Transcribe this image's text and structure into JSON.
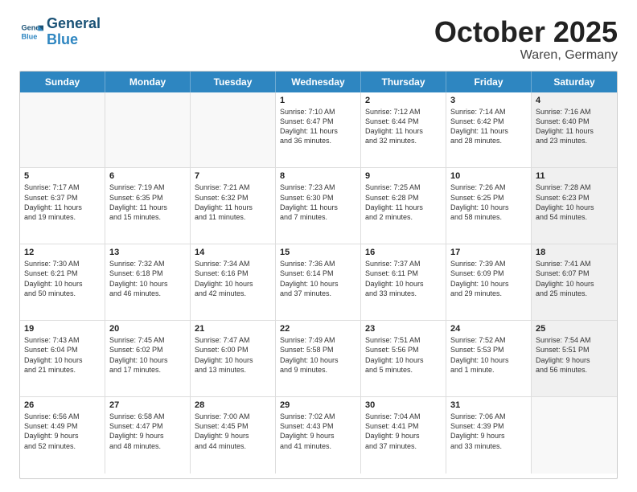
{
  "logo": {
    "line1": "General",
    "line2": "Blue"
  },
  "title": "October 2025",
  "location": "Waren, Germany",
  "header_days": [
    "Sunday",
    "Monday",
    "Tuesday",
    "Wednesday",
    "Thursday",
    "Friday",
    "Saturday"
  ],
  "weeks": [
    [
      {
        "day": "",
        "text": "",
        "empty": true
      },
      {
        "day": "",
        "text": "",
        "empty": true
      },
      {
        "day": "",
        "text": "",
        "empty": true
      },
      {
        "day": "1",
        "text": "Sunrise: 7:10 AM\nSunset: 6:47 PM\nDaylight: 11 hours\nand 36 minutes."
      },
      {
        "day": "2",
        "text": "Sunrise: 7:12 AM\nSunset: 6:44 PM\nDaylight: 11 hours\nand 32 minutes."
      },
      {
        "day": "3",
        "text": "Sunrise: 7:14 AM\nSunset: 6:42 PM\nDaylight: 11 hours\nand 28 minutes."
      },
      {
        "day": "4",
        "text": "Sunrise: 7:16 AM\nSunset: 6:40 PM\nDaylight: 11 hours\nand 23 minutes.",
        "shaded": true
      }
    ],
    [
      {
        "day": "5",
        "text": "Sunrise: 7:17 AM\nSunset: 6:37 PM\nDaylight: 11 hours\nand 19 minutes."
      },
      {
        "day": "6",
        "text": "Sunrise: 7:19 AM\nSunset: 6:35 PM\nDaylight: 11 hours\nand 15 minutes."
      },
      {
        "day": "7",
        "text": "Sunrise: 7:21 AM\nSunset: 6:32 PM\nDaylight: 11 hours\nand 11 minutes."
      },
      {
        "day": "8",
        "text": "Sunrise: 7:23 AM\nSunset: 6:30 PM\nDaylight: 11 hours\nand 7 minutes."
      },
      {
        "day": "9",
        "text": "Sunrise: 7:25 AM\nSunset: 6:28 PM\nDaylight: 11 hours\nand 2 minutes."
      },
      {
        "day": "10",
        "text": "Sunrise: 7:26 AM\nSunset: 6:25 PM\nDaylight: 10 hours\nand 58 minutes."
      },
      {
        "day": "11",
        "text": "Sunrise: 7:28 AM\nSunset: 6:23 PM\nDaylight: 10 hours\nand 54 minutes.",
        "shaded": true
      }
    ],
    [
      {
        "day": "12",
        "text": "Sunrise: 7:30 AM\nSunset: 6:21 PM\nDaylight: 10 hours\nand 50 minutes."
      },
      {
        "day": "13",
        "text": "Sunrise: 7:32 AM\nSunset: 6:18 PM\nDaylight: 10 hours\nand 46 minutes."
      },
      {
        "day": "14",
        "text": "Sunrise: 7:34 AM\nSunset: 6:16 PM\nDaylight: 10 hours\nand 42 minutes."
      },
      {
        "day": "15",
        "text": "Sunrise: 7:36 AM\nSunset: 6:14 PM\nDaylight: 10 hours\nand 37 minutes."
      },
      {
        "day": "16",
        "text": "Sunrise: 7:37 AM\nSunset: 6:11 PM\nDaylight: 10 hours\nand 33 minutes."
      },
      {
        "day": "17",
        "text": "Sunrise: 7:39 AM\nSunset: 6:09 PM\nDaylight: 10 hours\nand 29 minutes."
      },
      {
        "day": "18",
        "text": "Sunrise: 7:41 AM\nSunset: 6:07 PM\nDaylight: 10 hours\nand 25 minutes.",
        "shaded": true
      }
    ],
    [
      {
        "day": "19",
        "text": "Sunrise: 7:43 AM\nSunset: 6:04 PM\nDaylight: 10 hours\nand 21 minutes."
      },
      {
        "day": "20",
        "text": "Sunrise: 7:45 AM\nSunset: 6:02 PM\nDaylight: 10 hours\nand 17 minutes."
      },
      {
        "day": "21",
        "text": "Sunrise: 7:47 AM\nSunset: 6:00 PM\nDaylight: 10 hours\nand 13 minutes."
      },
      {
        "day": "22",
        "text": "Sunrise: 7:49 AM\nSunset: 5:58 PM\nDaylight: 10 hours\nand 9 minutes."
      },
      {
        "day": "23",
        "text": "Sunrise: 7:51 AM\nSunset: 5:56 PM\nDaylight: 10 hours\nand 5 minutes."
      },
      {
        "day": "24",
        "text": "Sunrise: 7:52 AM\nSunset: 5:53 PM\nDaylight: 10 hours\nand 1 minute."
      },
      {
        "day": "25",
        "text": "Sunrise: 7:54 AM\nSunset: 5:51 PM\nDaylight: 9 hours\nand 56 minutes.",
        "shaded": true
      }
    ],
    [
      {
        "day": "26",
        "text": "Sunrise: 6:56 AM\nSunset: 4:49 PM\nDaylight: 9 hours\nand 52 minutes."
      },
      {
        "day": "27",
        "text": "Sunrise: 6:58 AM\nSunset: 4:47 PM\nDaylight: 9 hours\nand 48 minutes."
      },
      {
        "day": "28",
        "text": "Sunrise: 7:00 AM\nSunset: 4:45 PM\nDaylight: 9 hours\nand 44 minutes."
      },
      {
        "day": "29",
        "text": "Sunrise: 7:02 AM\nSunset: 4:43 PM\nDaylight: 9 hours\nand 41 minutes."
      },
      {
        "day": "30",
        "text": "Sunrise: 7:04 AM\nSunset: 4:41 PM\nDaylight: 9 hours\nand 37 minutes."
      },
      {
        "day": "31",
        "text": "Sunrise: 7:06 AM\nSunset: 4:39 PM\nDaylight: 9 hours\nand 33 minutes."
      },
      {
        "day": "",
        "text": "",
        "empty": true,
        "shaded": true
      }
    ]
  ]
}
